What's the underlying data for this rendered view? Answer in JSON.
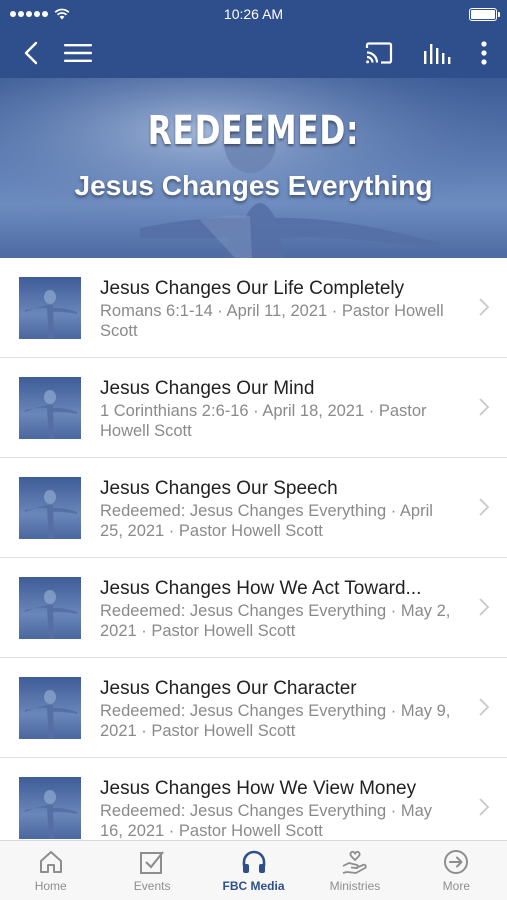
{
  "status": {
    "time": "10:26 AM",
    "battery_level": 1.0
  },
  "colors": {
    "brand": "#2f4f8c",
    "text": "#222222",
    "subtext": "#8a8a8a",
    "tab_inactive": "#8e8e8e"
  },
  "hero": {
    "title": "REDEEMED:",
    "subtitle": "Jesus Changes Everything"
  },
  "items": [
    {
      "title": "Jesus Changes Our Life Completely",
      "subtitle": "Romans 6:1-14 · April 11, 2021 · Pastor Howell Scott"
    },
    {
      "title": "Jesus Changes Our Mind",
      "subtitle": "1 Corinthians 2:6-16 · April 18, 2021 · Pastor Howell Scott"
    },
    {
      "title": "Jesus Changes Our Speech",
      "subtitle": "Redeemed: Jesus Changes Everything · April 25, 2021 · Pastor Howell Scott"
    },
    {
      "title": "Jesus Changes How We Act Toward...",
      "subtitle": "Redeemed: Jesus Changes Everything · May 2, 2021 · Pastor Howell Scott"
    },
    {
      "title": "Jesus Changes Our Character",
      "subtitle": "Redeemed: Jesus Changes Everything · May 9, 2021 · Pastor Howell Scott"
    },
    {
      "title": "Jesus Changes How We View Money",
      "subtitle": "Redeemed: Jesus Changes Everything · May 16, 2021 · Pastor Howell Scott"
    }
  ],
  "tabs": [
    {
      "label": "Home",
      "icon": "home-icon"
    },
    {
      "label": "Events",
      "icon": "checkbox-icon"
    },
    {
      "label": "FBC Media",
      "icon": "headphones-icon",
      "active": true
    },
    {
      "label": "Ministries",
      "icon": "hand-heart-icon"
    },
    {
      "label": "More",
      "icon": "arrow-circle-icon"
    }
  ]
}
